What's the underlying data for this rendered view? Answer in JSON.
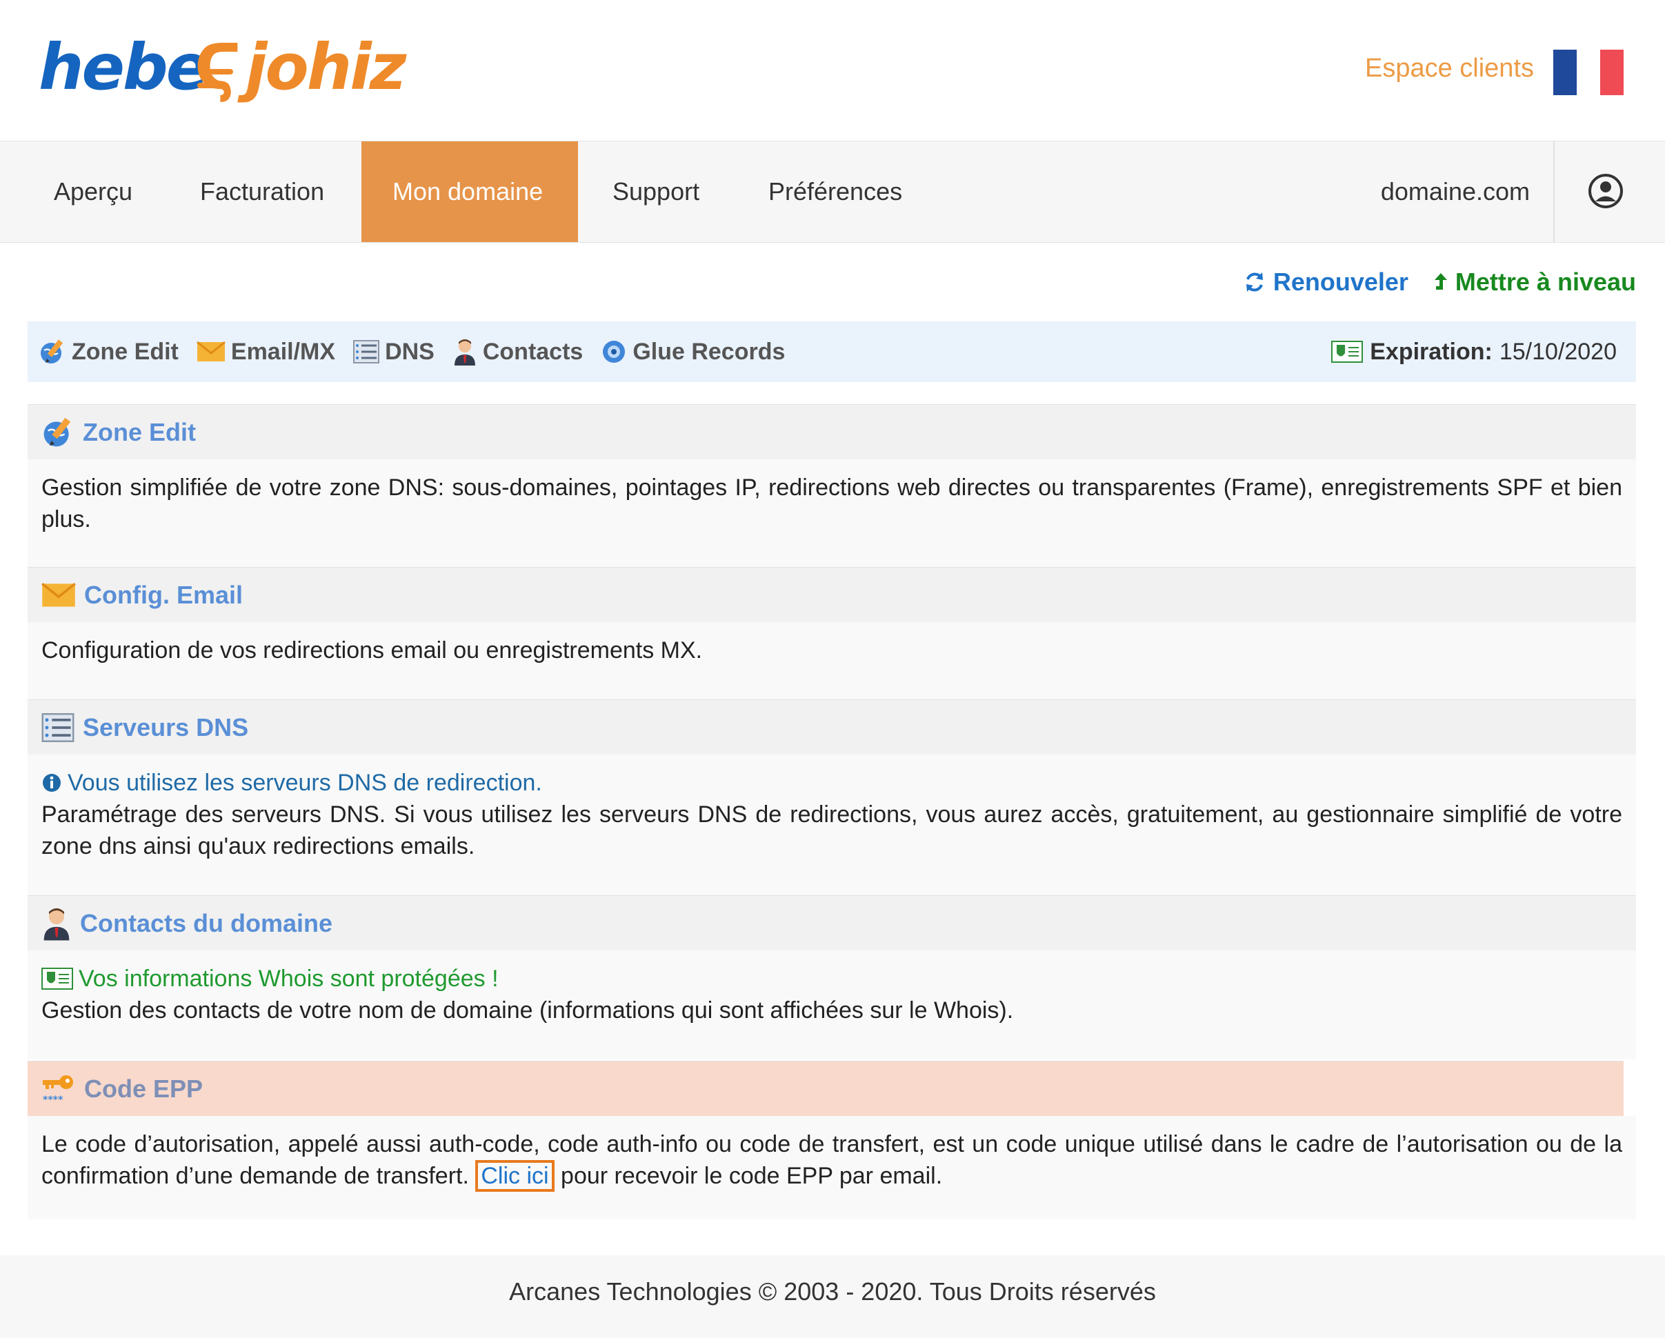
{
  "header": {
    "logo": {
      "part1": "hebe",
      "part2": "johiz"
    },
    "client_area_label": "Espace clients",
    "flag_colors": [
      "#1f4a9b",
      "#ffffff",
      "#ef4444"
    ]
  },
  "nav": {
    "items": [
      {
        "label": "Aperçu",
        "active": false
      },
      {
        "label": "Facturation",
        "active": false
      },
      {
        "label": "Mon domaine",
        "active": true
      },
      {
        "label": "Support",
        "active": false
      },
      {
        "label": "Préférences",
        "active": false
      }
    ],
    "domain": "domaine.com",
    "active_color": "#e6944a"
  },
  "actions": {
    "renew_label": "Renouveler",
    "upgrade_label": "Mettre à niveau"
  },
  "toolbar": {
    "items": [
      {
        "label": "Zone Edit",
        "icon": "pencil-globe-icon"
      },
      {
        "label": "Email/MX",
        "icon": "envelope-icon"
      },
      {
        "label": "DNS",
        "icon": "server-list-icon"
      },
      {
        "label": "Contacts",
        "icon": "person-icon"
      },
      {
        "label": "Glue Records",
        "icon": "glue-globe-icon"
      }
    ],
    "expiration_label": "Expiration:",
    "expiration_date": "15/10/2020"
  },
  "sections": {
    "zone_edit": {
      "title": "Zone Edit",
      "body": "Gestion simplifiée de votre zone DNS: sous-domaines, pointages IP, redirections web directes ou transparentes (Frame), enregistrements SPF et bien plus."
    },
    "email": {
      "title": "Config. Email",
      "body": "Configuration de vos redirections email ou enregistrements MX."
    },
    "dns": {
      "title": "Serveurs DNS",
      "notice": "Vous utilisez les serveurs DNS de redirection.",
      "body": "Paramétrage des serveurs DNS. Si vous utilisez les serveurs DNS de redirections, vous aurez accès, gratuitement, au gestionnaire simplifié de votre zone dns ainsi qu'aux redirections emails."
    },
    "contacts": {
      "title": "Contacts du domaine",
      "notice": "Vos informations Whois sont protégées !",
      "body": "Gestion des contacts de votre nom de domaine (informations qui sont affichées sur le Whois)."
    },
    "epp": {
      "title": "Code EPP",
      "body_before": "Le code d’autorisation, appelé aussi auth-code, code auth-info ou code de transfert, est un code unique utilisé dans le cadre de l’autorisation ou de la confirmation d’une demande de transfert. ",
      "link": "Clic ici",
      "body_after": " pour recevoir le code EPP par email."
    }
  },
  "footer": {
    "text": "Arcanes Technologies © 2003 - 2020. Tous Droits réservés"
  }
}
